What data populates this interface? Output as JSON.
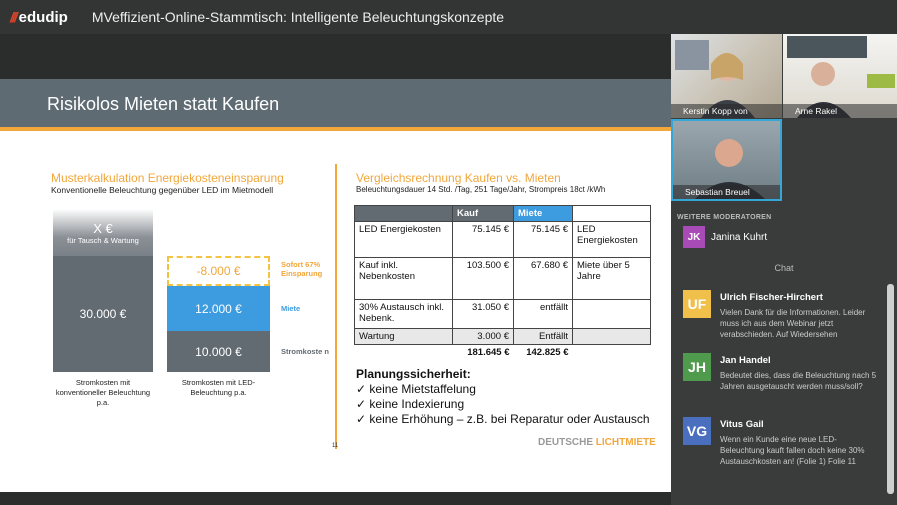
{
  "app": {
    "logo_text": "edudip",
    "title": "MVeffizient-Online-Stammtisch: Intelligente Beleuchtungskonzepte"
  },
  "slide": {
    "title": "Risikolos Mieten statt Kaufen",
    "left_title": "Musterkalkulation Energiekosteneinsparung",
    "left_sub": "Konventionelle Beleuchtung gegenüber LED im Mietmodell",
    "bar_x_main": "X €",
    "bar_x_sub": "für Tausch & Wartung",
    "bar_30": "30.000 €",
    "bar_minus8": "-8.000 €",
    "bar_12": "12.000 €",
    "bar_10": "10.000 €",
    "side_sofort": "Sofort 67% Einsparung",
    "side_miete": "Miete",
    "side_strom": "Stromkoste n",
    "cap_left": "Stromkosten mit konventioneller Beleuchtung p.a.",
    "cap_right": "Stromkosten mit LED-Beleuchtung p.a.",
    "right_title": "Vergleichsrechnung Kaufen vs. Mieten",
    "right_sub": "Beleuchtungsdauer 14 Std. /Tag, 251 Tage/Jahr, Strompreis 18ct /kWh",
    "table_head": [
      "",
      "Kauf",
      "Miete",
      ""
    ],
    "table_rows": [
      [
        "LED Energiekosten",
        "75.145 €",
        "75.145 €",
        "LED Energiekosten"
      ],
      [
        "Kauf inkl. Nebenkosten",
        "103.500 €",
        "67.680 €",
        "Miete über 5 Jahre"
      ],
      [
        "30% Austausch inkl. Nebenk.",
        "31.050 €",
        "entfällt",
        ""
      ],
      [
        "Wartung",
        "3.000 €",
        "Entfällt",
        ""
      ]
    ],
    "table_sum": [
      "181.645 €",
      "142.825 €"
    ],
    "plan_title": "Planungssicherheit:",
    "plan_items": [
      "✓  keine Mietstaffelung",
      "✓  keine Indexierung",
      "✓  keine Erhöhung – z.B. bei Reparatur oder Austausch"
    ],
    "page_num": "11",
    "brand_a": "DEUTSCHE ",
    "brand_b": "LICHTMIETE"
  },
  "videos": [
    {
      "name": "Kerstin Kopp von MVe..."
    },
    {
      "name": "Arne Rakel"
    },
    {
      "name": "Sebastian Breuel"
    }
  ],
  "moderators": {
    "label": "WEITERE MODERATOREN",
    "initials": "JK",
    "name": "Janina Kuhrt"
  },
  "chat": {
    "label": "Chat",
    "messages": [
      {
        "initials": "UF",
        "name": "Ulrich Fischer-Hirchert",
        "text": "Vielen Dank für die Informationen. Leider muss ich aus dem Webinar jetzt verabschieden. Auf Wiedersehen",
        "color": "#f0c04a"
      },
      {
        "initials": "JH",
        "name": "Jan Handel",
        "text": "Bedeutet dies, dass die Beleuchtung nach 5 Jahren ausgetauscht werden muss/soll?",
        "color": "#4f9a4d"
      },
      {
        "initials": "VG",
        "name": "Vitus Gail",
        "text": "Wenn ein Kunde eine neue LED-Beleuchtung kauft fallen doch keine 30% Austauschkosten an! (Folie 1) Folie 11",
        "color": "#4a6fbf"
      }
    ]
  },
  "colors": {
    "accent": "#f2a73b",
    "blue": "#3d9be0",
    "gray": "#636b72",
    "brand_red": "#d9452b"
  }
}
